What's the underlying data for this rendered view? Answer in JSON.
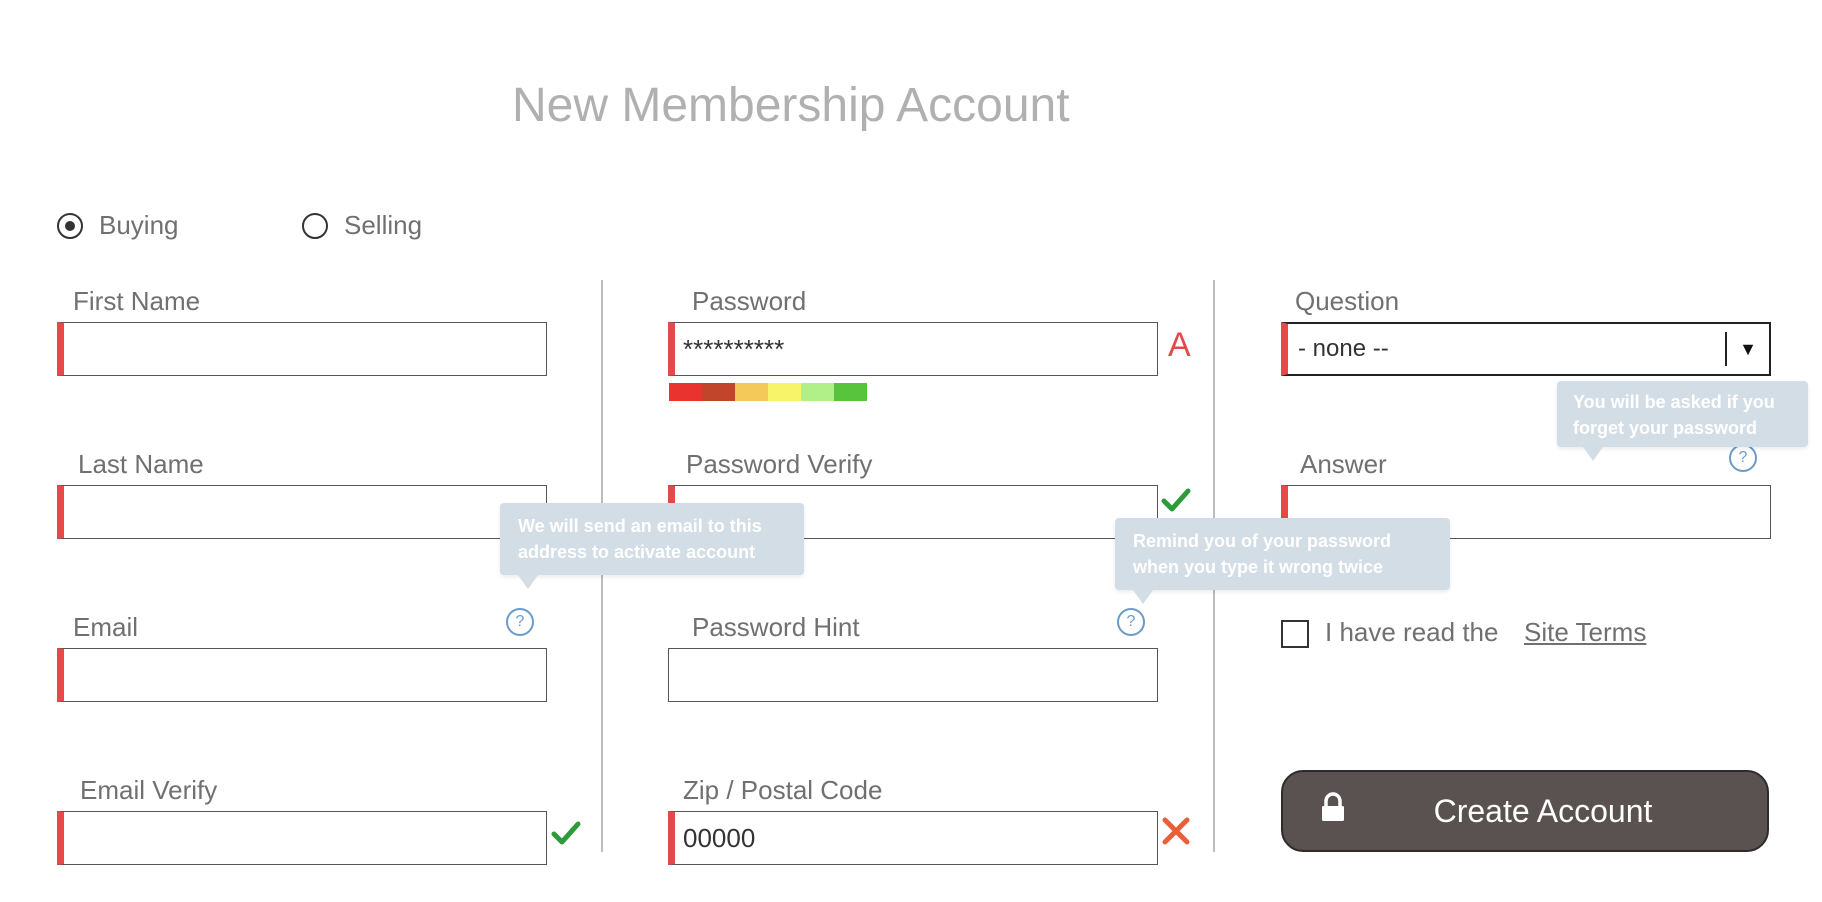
{
  "page_title": "New Membership Account",
  "account_type": {
    "options": [
      {
        "label": "Buying",
        "selected": true
      },
      {
        "label": "Selling",
        "selected": false
      }
    ]
  },
  "col1": {
    "first_name": {
      "label": "First Name",
      "value": ""
    },
    "last_name": {
      "label": "Last Name",
      "value": ""
    },
    "email": {
      "label": "Email",
      "value": "",
      "tooltip": "We will send an email to this address to activate account"
    },
    "email_verify": {
      "label": "Email Verify",
      "value": ""
    }
  },
  "col2": {
    "password": {
      "label": "Password",
      "value": "**********",
      "warning": "A"
    },
    "password_verify": {
      "label": "Password Verify",
      "value": ""
    },
    "password_hint": {
      "label": "Password Hint",
      "value": "",
      "tooltip": "Remind you of your password when you type it wrong twice"
    },
    "zip": {
      "label": "Zip / Postal Code",
      "value": "00000"
    }
  },
  "col3": {
    "question": {
      "label": "Question",
      "selected": "- none --"
    },
    "answer": {
      "label": "Answer",
      "value": "",
      "tooltip": "You will be asked if you forget your password"
    },
    "terms": {
      "text": "I have read the",
      "link": "Site Terms",
      "checked": false
    }
  },
  "create_button": {
    "label": "Create Account"
  },
  "help_glyph": "?",
  "strength_colors": [
    "#e8332e",
    "#c0452a",
    "#f4c95a",
    "#f7f46a",
    "#b1ef89",
    "#58c43d"
  ],
  "icons": {
    "valid": "check-icon",
    "invalid": "cross-icon",
    "help": "help-icon",
    "lock": "lock-icon",
    "dropdown": "triangle-down-icon"
  },
  "colors": {
    "required_marker": "#e34a4a",
    "valid": "#2e9b3b",
    "invalid": "#e8603a",
    "tooltip_bg": "#d3dde6",
    "button_bg": "#595250"
  }
}
